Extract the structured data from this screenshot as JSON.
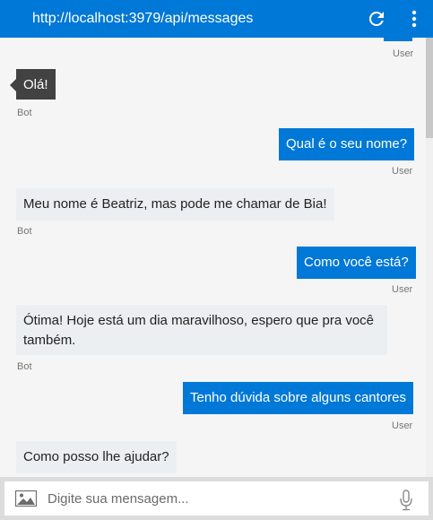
{
  "header": {
    "url": "http://localhost:3979/api/messages"
  },
  "messages": [
    {
      "from": "bot",
      "text": "Olá!",
      "sender": "Bot"
    },
    {
      "from": "user",
      "text": "Qual é o seu nome?",
      "sender": "User"
    },
    {
      "from": "bot",
      "text": "Meu nome é Beatriz, mas pode me chamar de Bia!",
      "sender": "Bot"
    },
    {
      "from": "user",
      "text": "Como você está?",
      "sender": "User"
    },
    {
      "from": "bot",
      "line1": "Ótima! Hoje está um dia maravilhoso, espero que pra você",
      "line2": "também.",
      "sender": "Bot"
    },
    {
      "from": "user",
      "text": "Tenho dúvida sobre alguns cantores",
      "sender": "User"
    },
    {
      "from": "bot",
      "text": "Como posso lhe ajudar?",
      "sender": ""
    }
  ],
  "top_sender": "User",
  "input": {
    "placeholder": "Digite sua mensagem..."
  },
  "icons": {
    "refresh": "refresh-icon",
    "menu": "more-vertical-icon",
    "image": "image-upload-icon",
    "mic": "microphone-icon"
  },
  "colors": {
    "accent": "#0078d7",
    "bot_bubble": "#eceff1",
    "dark_bubble": "#424242"
  }
}
